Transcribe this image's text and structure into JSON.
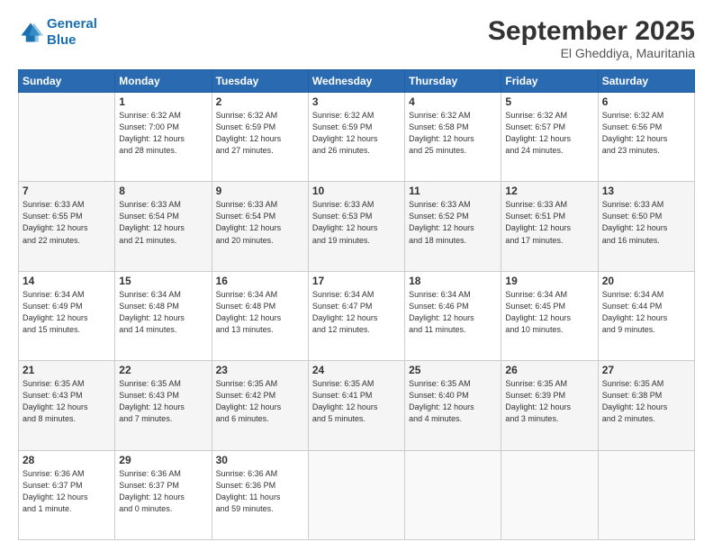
{
  "header": {
    "logo_line1": "General",
    "logo_line2": "Blue",
    "title": "September 2025",
    "subtitle": "El Gheddiya, Mauritania"
  },
  "weekdays": [
    "Sunday",
    "Monday",
    "Tuesday",
    "Wednesday",
    "Thursday",
    "Friday",
    "Saturday"
  ],
  "weeks": [
    [
      {
        "day": "",
        "info": ""
      },
      {
        "day": "1",
        "info": "Sunrise: 6:32 AM\nSunset: 7:00 PM\nDaylight: 12 hours\nand 28 minutes."
      },
      {
        "day": "2",
        "info": "Sunrise: 6:32 AM\nSunset: 6:59 PM\nDaylight: 12 hours\nand 27 minutes."
      },
      {
        "day": "3",
        "info": "Sunrise: 6:32 AM\nSunset: 6:59 PM\nDaylight: 12 hours\nand 26 minutes."
      },
      {
        "day": "4",
        "info": "Sunrise: 6:32 AM\nSunset: 6:58 PM\nDaylight: 12 hours\nand 25 minutes."
      },
      {
        "day": "5",
        "info": "Sunrise: 6:32 AM\nSunset: 6:57 PM\nDaylight: 12 hours\nand 24 minutes."
      },
      {
        "day": "6",
        "info": "Sunrise: 6:32 AM\nSunset: 6:56 PM\nDaylight: 12 hours\nand 23 minutes."
      }
    ],
    [
      {
        "day": "7",
        "info": "Sunrise: 6:33 AM\nSunset: 6:55 PM\nDaylight: 12 hours\nand 22 minutes."
      },
      {
        "day": "8",
        "info": "Sunrise: 6:33 AM\nSunset: 6:54 PM\nDaylight: 12 hours\nand 21 minutes."
      },
      {
        "day": "9",
        "info": "Sunrise: 6:33 AM\nSunset: 6:54 PM\nDaylight: 12 hours\nand 20 minutes."
      },
      {
        "day": "10",
        "info": "Sunrise: 6:33 AM\nSunset: 6:53 PM\nDaylight: 12 hours\nand 19 minutes."
      },
      {
        "day": "11",
        "info": "Sunrise: 6:33 AM\nSunset: 6:52 PM\nDaylight: 12 hours\nand 18 minutes."
      },
      {
        "day": "12",
        "info": "Sunrise: 6:33 AM\nSunset: 6:51 PM\nDaylight: 12 hours\nand 17 minutes."
      },
      {
        "day": "13",
        "info": "Sunrise: 6:33 AM\nSunset: 6:50 PM\nDaylight: 12 hours\nand 16 minutes."
      }
    ],
    [
      {
        "day": "14",
        "info": "Sunrise: 6:34 AM\nSunset: 6:49 PM\nDaylight: 12 hours\nand 15 minutes."
      },
      {
        "day": "15",
        "info": "Sunrise: 6:34 AM\nSunset: 6:48 PM\nDaylight: 12 hours\nand 14 minutes."
      },
      {
        "day": "16",
        "info": "Sunrise: 6:34 AM\nSunset: 6:48 PM\nDaylight: 12 hours\nand 13 minutes."
      },
      {
        "day": "17",
        "info": "Sunrise: 6:34 AM\nSunset: 6:47 PM\nDaylight: 12 hours\nand 12 minutes."
      },
      {
        "day": "18",
        "info": "Sunrise: 6:34 AM\nSunset: 6:46 PM\nDaylight: 12 hours\nand 11 minutes."
      },
      {
        "day": "19",
        "info": "Sunrise: 6:34 AM\nSunset: 6:45 PM\nDaylight: 12 hours\nand 10 minutes."
      },
      {
        "day": "20",
        "info": "Sunrise: 6:34 AM\nSunset: 6:44 PM\nDaylight: 12 hours\nand 9 minutes."
      }
    ],
    [
      {
        "day": "21",
        "info": "Sunrise: 6:35 AM\nSunset: 6:43 PM\nDaylight: 12 hours\nand 8 minutes."
      },
      {
        "day": "22",
        "info": "Sunrise: 6:35 AM\nSunset: 6:43 PM\nDaylight: 12 hours\nand 7 minutes."
      },
      {
        "day": "23",
        "info": "Sunrise: 6:35 AM\nSunset: 6:42 PM\nDaylight: 12 hours\nand 6 minutes."
      },
      {
        "day": "24",
        "info": "Sunrise: 6:35 AM\nSunset: 6:41 PM\nDaylight: 12 hours\nand 5 minutes."
      },
      {
        "day": "25",
        "info": "Sunrise: 6:35 AM\nSunset: 6:40 PM\nDaylight: 12 hours\nand 4 minutes."
      },
      {
        "day": "26",
        "info": "Sunrise: 6:35 AM\nSunset: 6:39 PM\nDaylight: 12 hours\nand 3 minutes."
      },
      {
        "day": "27",
        "info": "Sunrise: 6:35 AM\nSunset: 6:38 PM\nDaylight: 12 hours\nand 2 minutes."
      }
    ],
    [
      {
        "day": "28",
        "info": "Sunrise: 6:36 AM\nSunset: 6:37 PM\nDaylight: 12 hours\nand 1 minute."
      },
      {
        "day": "29",
        "info": "Sunrise: 6:36 AM\nSunset: 6:37 PM\nDaylight: 12 hours\nand 0 minutes."
      },
      {
        "day": "30",
        "info": "Sunrise: 6:36 AM\nSunset: 6:36 PM\nDaylight: 11 hours\nand 59 minutes."
      },
      {
        "day": "",
        "info": ""
      },
      {
        "day": "",
        "info": ""
      },
      {
        "day": "",
        "info": ""
      },
      {
        "day": "",
        "info": ""
      }
    ]
  ]
}
